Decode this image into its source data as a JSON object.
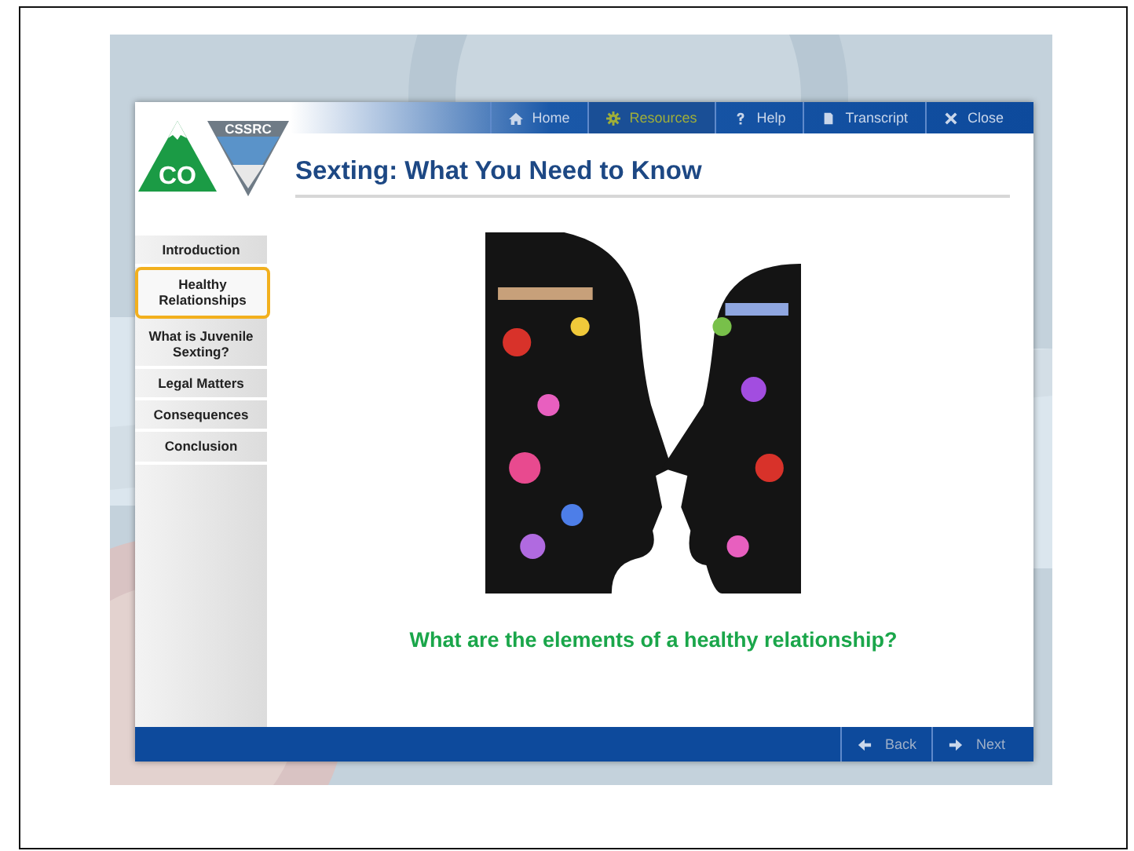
{
  "logo": {
    "state": "CO",
    "agency": "CSSRC"
  },
  "toolbar": [
    {
      "label": "Home",
      "kind": "home",
      "selected": false
    },
    {
      "label": "Resources",
      "kind": "gear",
      "selected": true
    },
    {
      "label": "Help",
      "kind": "help",
      "selected": false
    },
    {
      "label": "Transcript",
      "kind": "page",
      "selected": false
    },
    {
      "label": "Close",
      "kind": "close",
      "selected": false
    }
  ],
  "title": "Sexting: What You Need to Know",
  "sidebar": {
    "items": [
      {
        "label": "Introduction",
        "selected": false
      },
      {
        "label": "Healthy Relationships",
        "selected": true
      },
      {
        "label": "What is Juvenile Sexting?",
        "selected": false
      },
      {
        "label": "Legal Matters",
        "selected": false
      },
      {
        "label": "Consequences",
        "selected": false
      },
      {
        "label": "Conclusion",
        "selected": false
      }
    ]
  },
  "content": {
    "question": "What are the elements of a healthy relationship?"
  },
  "footer": [
    {
      "label": "Back",
      "kind": "left"
    },
    {
      "label": "Next",
      "kind": "right"
    }
  ]
}
